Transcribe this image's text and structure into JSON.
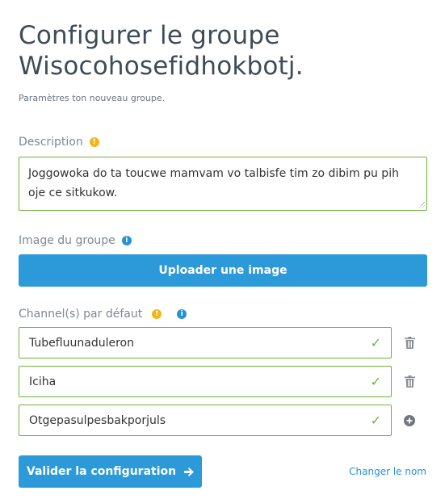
{
  "header": {
    "title": "Configurer le groupe Wisocohosefidhokbotj.",
    "subtitle": "Paramètres ton nouveau groupe."
  },
  "description": {
    "label": "Description",
    "info_icon": "exclamation-icon",
    "value": "Joggowoka do ta toucwe mamvam vo talbisfe tim zo dibim pu pih oje ce sitkukow."
  },
  "image": {
    "label": "Image du groupe",
    "info_icon": "info-icon",
    "upload_label": "Uploader une image"
  },
  "channels": {
    "label": "Channel(s) par défaut",
    "items": [
      {
        "value": "Tubefluunaduleron",
        "action_icon": "trash-icon"
      },
      {
        "value": "Iciha",
        "action_icon": "trash-icon"
      },
      {
        "value": "Otgepasulpesbakporjuls",
        "action_icon": "plus-circle-icon"
      }
    ]
  },
  "footer": {
    "submit_label": "Valider la configuration",
    "submit_icon": "arrow-right-icon",
    "rename_link": "Changer le nom"
  },
  "colors": {
    "primary": "#2c9ad9",
    "valid_border": "#6fb23c",
    "warning": "#f2b51b",
    "info": "#2a90d6"
  }
}
